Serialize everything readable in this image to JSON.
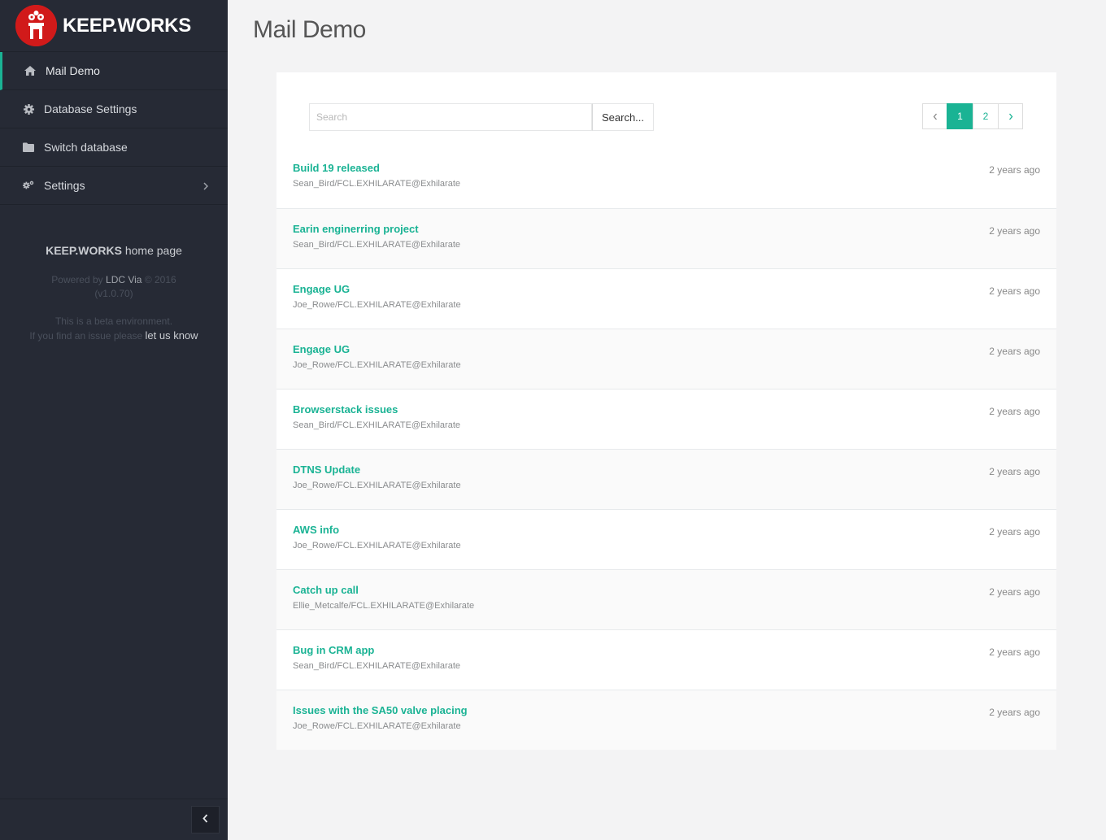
{
  "brand": {
    "name": "KEEP.WORKS"
  },
  "sidebar": {
    "items": [
      {
        "label": "Mail Demo",
        "icon": "home-icon",
        "active": true
      },
      {
        "label": "Database Settings",
        "icon": "gear-icon",
        "active": false
      },
      {
        "label": "Switch database",
        "icon": "folder-icon",
        "active": false
      },
      {
        "label": "Settings",
        "icon": "gears-icon",
        "active": false
      }
    ],
    "home_bold": "KEEP.WORKS",
    "home_rest": "home page",
    "powered_prefix": "Powered by",
    "powered_link": "LDC Via",
    "powered_suffix": "© 2016",
    "version": "(v1.0.70)",
    "beta_line1": "This is a beta environment.",
    "beta_line2": "If you find an issue please",
    "beta_link": "let us know"
  },
  "page": {
    "title": "Mail Demo"
  },
  "search": {
    "placeholder": "Search",
    "button_label": "Search..."
  },
  "pager": {
    "pages": [
      "1",
      "2"
    ],
    "current": "1"
  },
  "mails": [
    {
      "subject": "Build 19 released",
      "from": "Sean_Bird/FCL.EXHILARATE@Exhilarate",
      "time": "2 years ago"
    },
    {
      "subject": "Earin enginerring project",
      "from": "Sean_Bird/FCL.EXHILARATE@Exhilarate",
      "time": "2 years ago"
    },
    {
      "subject": "Engage UG",
      "from": "Joe_Rowe/FCL.EXHILARATE@Exhilarate",
      "time": "2 years ago"
    },
    {
      "subject": "Engage UG",
      "from": "Joe_Rowe/FCL.EXHILARATE@Exhilarate",
      "time": "2 years ago"
    },
    {
      "subject": "Browserstack issues",
      "from": "Sean_Bird/FCL.EXHILARATE@Exhilarate",
      "time": "2 years ago"
    },
    {
      "subject": "DTNS Update",
      "from": "Joe_Rowe/FCL.EXHILARATE@Exhilarate",
      "time": "2 years ago"
    },
    {
      "subject": "AWS info",
      "from": "Joe_Rowe/FCL.EXHILARATE@Exhilarate",
      "time": "2 years ago"
    },
    {
      "subject": "Catch up call",
      "from": "Ellie_Metcalfe/FCL.EXHILARATE@Exhilarate",
      "time": "2 years ago"
    },
    {
      "subject": "Bug in CRM app",
      "from": "Sean_Bird/FCL.EXHILARATE@Exhilarate",
      "time": "2 years ago"
    },
    {
      "subject": "Issues with the SA50 valve placing",
      "from": "Joe_Rowe/FCL.EXHILARATE@Exhilarate",
      "time": "2 years ago"
    }
  ],
  "colors": {
    "accent": "#1ab394",
    "sidebar": "#262a35",
    "logo": "#d11a1a"
  }
}
